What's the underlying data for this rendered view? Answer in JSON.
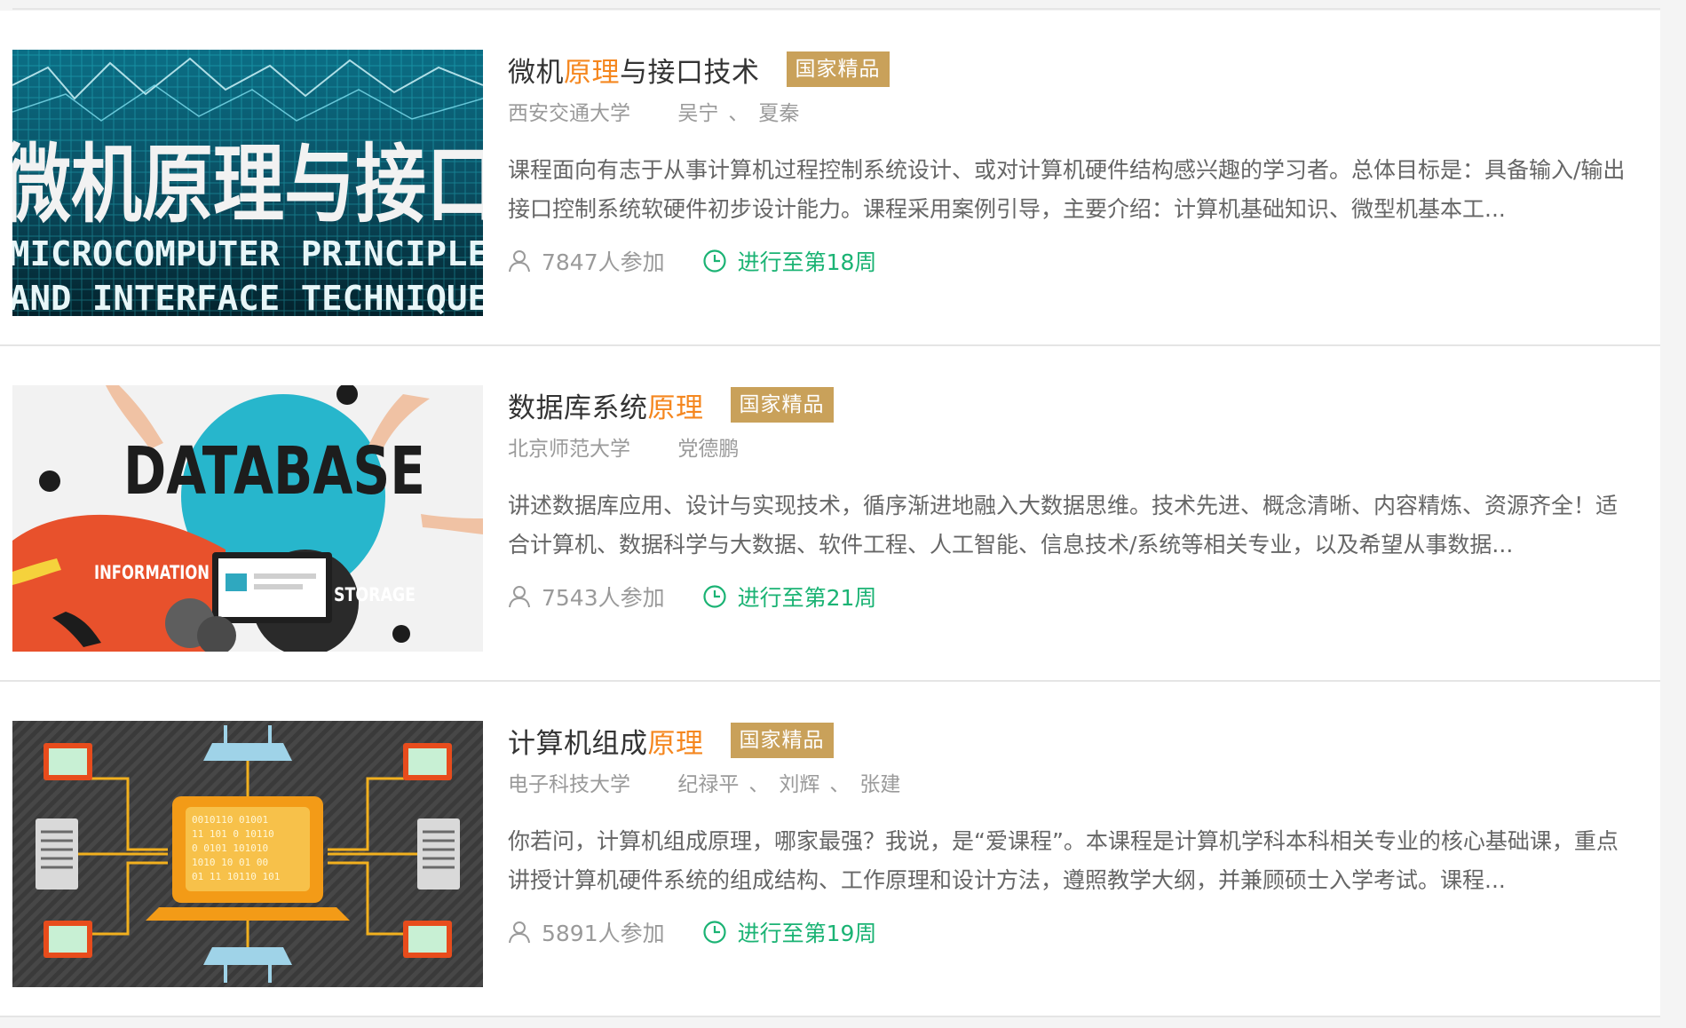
{
  "courses": [
    {
      "title_before": "微机",
      "title_highlight": "原理",
      "title_after": "与接口技术",
      "badge": "国家精品",
      "school": "西安交通大学",
      "teachers": [
        "吴宁",
        "夏秦"
      ],
      "description": "课程面向有志于从事计算机过程控制系统设计、或对计算机硬件结构感兴趣的学习者。总体目标是：具备输入/输出接口控制系统软硬件初步设计能力。课程采用案例引导，主要介绍：计算机基础知识、微型机基本工...",
      "participants": "7847人参加",
      "progress": "进行至第18周",
      "thumb": {
        "main_text": "微机原理与接口",
        "line1": "MICROCOMPUTER PRINCIPLE",
        "line2": "AND INTERFACE TECHNIQUE"
      }
    },
    {
      "title_before": "数据库系统",
      "title_highlight": "原理",
      "title_after": "",
      "badge": "国家精品",
      "school": "北京师范大学",
      "teachers": [
        "党德鹏"
      ],
      "description": "讲述数据库应用、设计与实现技术，循序渐进地融入大数据思维。技术先进、概念清晰、内容精炼、资源齐全！适合计算机、数据科学与大数据、软件工程、人工智能、信息技术/系统等相关专业，以及希望从事数据...",
      "participants": "7543人参加",
      "progress": "进行至第21周",
      "thumb": {
        "main_text": "DATABASE",
        "left_label": "INFORMATION",
        "right_label": "STORAGE"
      }
    },
    {
      "title_before": "计算机组成",
      "title_highlight": "原理",
      "title_after": "",
      "badge": "国家精品",
      "school": "电子科技大学",
      "teachers": [
        "纪禄平",
        "刘辉",
        "张建"
      ],
      "description": "你若问，计算机组成原理，哪家最强？我说，是“爱课程”。本课程是计算机学科本科相关专业的核心基础课，重点讲授计算机硬件系统的组成结构、工作原理和设计方法，遵照教学大纲，并兼顾硕士入学考试。课程...",
      "participants": "5891人参加",
      "progress": "进行至第19周",
      "thumb": {}
    }
  ],
  "colors": {
    "highlight": "#f5871f",
    "badge": "#c9a15a",
    "progress": "#1bb374",
    "muted": "#9a9a9a"
  },
  "icons": {
    "participants": "user-icon",
    "progress": "clock-icon"
  }
}
